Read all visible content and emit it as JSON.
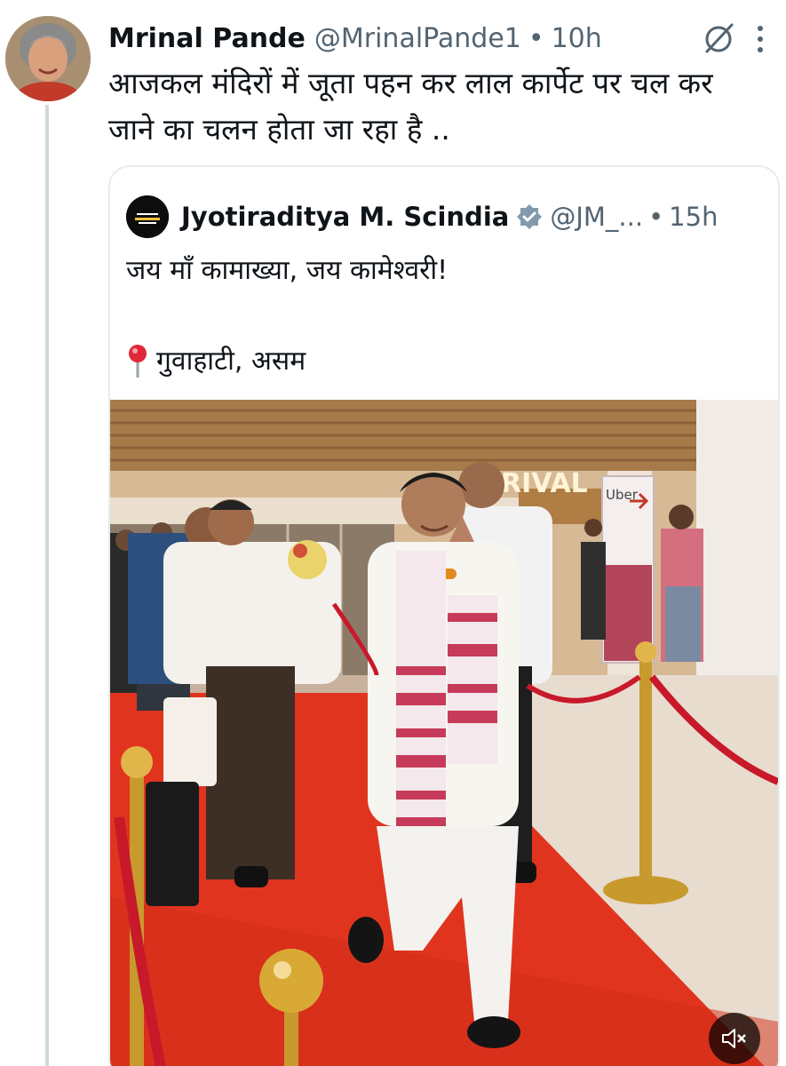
{
  "tweet": {
    "display_name": "Mrinal Pande",
    "handle": "@MrinalPande1",
    "separator": "•",
    "time": "10h",
    "text": "आजकल मंदिरों में जूता पहन कर लाल कार्पेट पर चल कर जाने का चलन होता जा रहा है ..",
    "avatar_icon": "user-avatar-photo",
    "grok_icon": "grok-icon",
    "more_icon": "more-dots-icon"
  },
  "quote": {
    "display_name": "Jyotiraditya M. Scindia",
    "handle": "@JM_...",
    "separator": "•",
    "time": "15h",
    "text": "जय माँ कामाख्या, जय कामेश्वरी!",
    "location": "गुवाहाटी, असम",
    "verified_icon": "verified-badge-icon",
    "verified_color": "#829aab",
    "media": {
      "sign_text": "RIVAL",
      "uber_text": "Uber"
    },
    "mute_icon": "speaker-muted-icon"
  },
  "colors": {
    "text_primary": "#0f1419",
    "text_secondary": "#536471",
    "border": "#e6ecf0",
    "carpet": "#e0341f",
    "rope": "#c8192a",
    "gold": "#c89a2e"
  }
}
